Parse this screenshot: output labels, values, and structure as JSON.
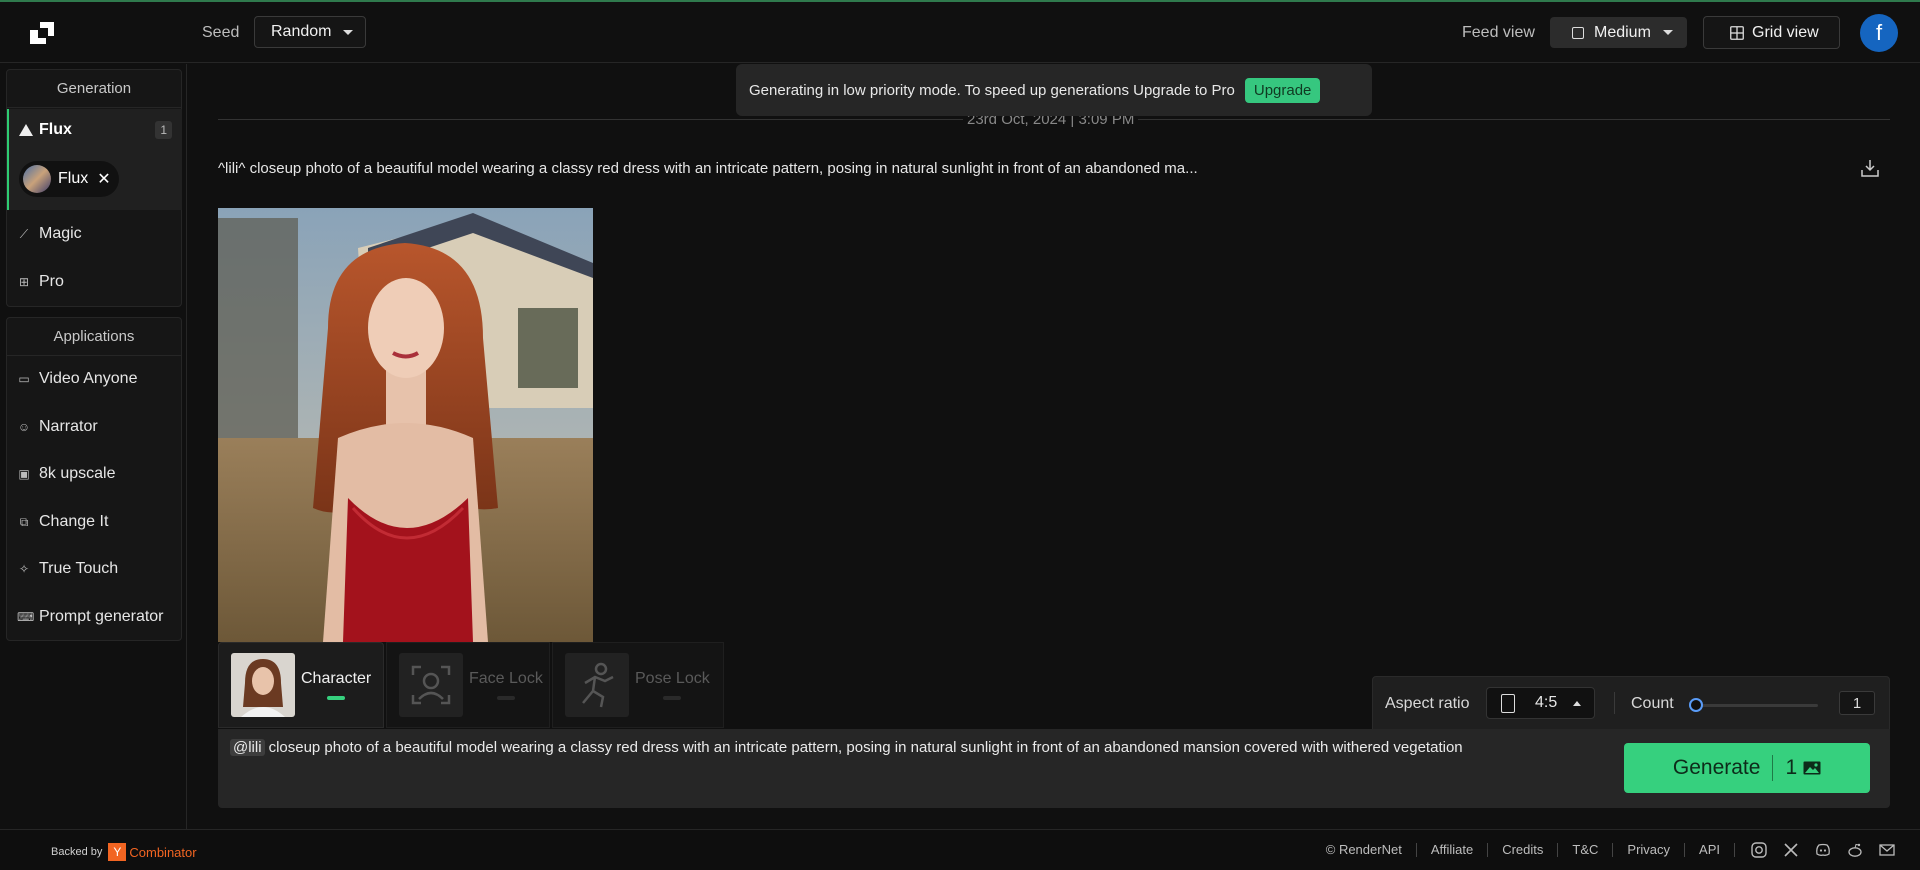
{
  "header": {
    "seed_label": "Seed",
    "seed_value": "Random",
    "feed_label": "Feed view",
    "feed_value": "Medium",
    "grid_label": "Grid view",
    "avatar_letter": "f"
  },
  "sidebar": {
    "generation_title": "Generation",
    "flux_label": "Flux",
    "flux_count": "1",
    "flux_chip": "Flux",
    "magic": "Magic",
    "pro": "Pro",
    "applications_title": "Applications",
    "apps": [
      "Video Anyone",
      "Narrator",
      "8k upscale",
      "Change It",
      "True Touch",
      "Prompt generator"
    ]
  },
  "notice": {
    "text": "Generating in low priority mode. To speed up generations Upgrade to Pro",
    "button": "Upgrade"
  },
  "feed": {
    "date": "23rd Oct, 2024 | 3:09 PM",
    "prompt_summary": "^lili^ closeup photo of a beautiful model wearing a classy red dress with an intricate pattern, posing in natural sunlight in front of an abandoned ma..."
  },
  "controls": {
    "tabs": [
      "Character",
      "Face Lock",
      "Pose Lock"
    ],
    "aspect_label": "Aspect ratio",
    "aspect_value": "4:5",
    "count_label": "Count",
    "count_value": "1",
    "mention": "@lili",
    "prompt": "closeup photo of a beautiful model wearing a classy red dress with an intricate pattern, posing in natural sunlight in front of an abandoned mansion covered with withered vegetation",
    "generate_label": "Generate",
    "generate_count": "1"
  },
  "footer": {
    "backed_by": "Backed by",
    "yc_letter": "Y",
    "yc_name": "Combinator",
    "links": [
      "© RenderNet",
      "Affiliate",
      "Credits",
      "T&C",
      "Privacy",
      "API"
    ]
  },
  "colors": {
    "accent": "#36d07e",
    "avatar": "#1565c0",
    "yc": "#f26522"
  }
}
